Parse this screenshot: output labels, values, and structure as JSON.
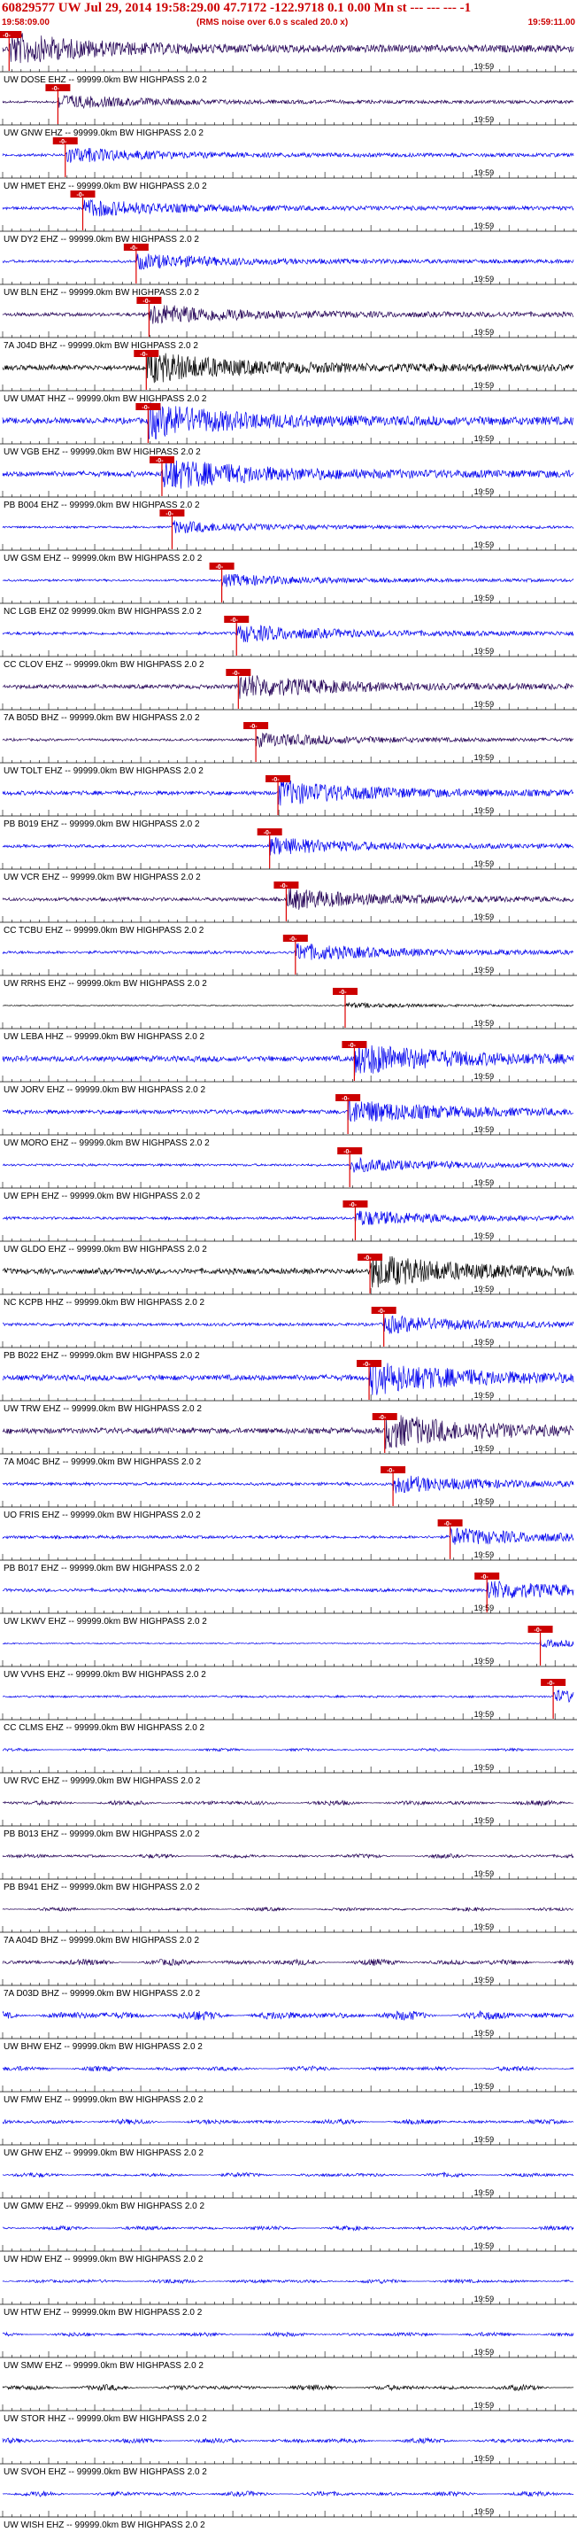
{
  "header": {
    "title": "60829577 UW Jul 29, 2014 19:58:29.00   47.7172  -122.9718   0.1 0.00 Mn st --- --- ---  -1",
    "start_time": "19:58:09.00",
    "noise_note": "(RMS noise over 6.0 s scaled 20.0 x)",
    "end_time": "19:59:11.00"
  },
  "colors": {
    "trace_blue": "#0000ee",
    "trace_purple": "#220055",
    "trace_black": "#000000",
    "pick_red": "#dd0000",
    "pick_box": "#cc0000",
    "axis": "#000000"
  },
  "chart_data": {
    "type": "line",
    "x_range": [
      "19:58:09.00",
      "19:59:11.00"
    ],
    "tick_label": "19:59",
    "tick_label_seconds": 51,
    "tick_interval_seconds": 5,
    "total_seconds": 62,
    "pick_label": "-0-",
    "traces": [
      {
        "label": "UW DOSE EHZ -- 99999.0km BW  HIGHPASS  2.0  2",
        "pick": 0.7,
        "amp": 0.9,
        "color": "purple"
      },
      {
        "label": "UW GNW EHZ -- 99999.0km BW  HIGHPASS  2.0  2",
        "pick": 6.0,
        "amp": 0.4,
        "color": "purple"
      },
      {
        "label": "UW HMET EHZ -- 99999.0km BW  HIGHPASS  2.0  2",
        "pick": 6.8,
        "amp": 0.45,
        "color": "blue"
      },
      {
        "label": "UW DY2 EHZ -- 99999.0km BW  HIGHPASS  2.0  2",
        "pick": 8.7,
        "amp": 0.5,
        "color": "blue"
      },
      {
        "label": "UW BLN EHZ -- 99999.0km BW  HIGHPASS  2.0  2",
        "pick": 14.5,
        "amp": 0.45,
        "color": "blue"
      },
      {
        "label": "7A J04D BHZ -- 99999.0km BW  HIGHPASS  2.0  2",
        "pick": 15.9,
        "amp": 0.6,
        "color": "purple"
      },
      {
        "label": "UW UMAT HHZ -- 99999.0km BW  HIGHPASS  2.0  2",
        "pick": 15.6,
        "amp": 0.9,
        "color": "black"
      },
      {
        "label": "UW VGB EHZ -- 99999.0km BW  HIGHPASS  2.0  2",
        "pick": 15.8,
        "amp": 1.0,
        "color": "blue"
      },
      {
        "label": "PB B004 EHZ -- 99999.0km BW  HIGHPASS  2.0  2",
        "pick": 17.3,
        "amp": 0.9,
        "color": "blue"
      },
      {
        "label": "UW GSM EHZ -- 99999.0km BW  HIGHPASS  2.0  2",
        "pick": 18.4,
        "amp": 0.35,
        "color": "blue"
      },
      {
        "label": "NC LGB EHZ 02 99999.0km BW  HIGHPASS  2.0  2",
        "pick": 23.8,
        "amp": 0.35,
        "color": "blue"
      },
      {
        "label": "CC CLOV EHZ -- 99999.0km BW  HIGHPASS  2.0  2",
        "pick": 25.4,
        "amp": 0.5,
        "color": "blue"
      },
      {
        "label": "7A B05D BHZ -- 99999.0km BW  HIGHPASS  2.0  2",
        "pick": 25.6,
        "amp": 0.7,
        "color": "purple"
      },
      {
        "label": "UW TOLT EHZ -- 99999.0km BW  HIGHPASS  2.0  2",
        "pick": 27.5,
        "amp": 0.4,
        "color": "purple"
      },
      {
        "label": "PB B019 EHZ -- 99999.0km BW  HIGHPASS  2.0  2",
        "pick": 29.9,
        "amp": 0.7,
        "color": "blue"
      },
      {
        "label": "UW VCR EHZ -- 99999.0km BW  HIGHPASS  2.0  2",
        "pick": 29.0,
        "amp": 0.5,
        "color": "blue"
      },
      {
        "label": "CC TCBU EHZ -- 99999.0km BW  HIGHPASS  2.0  2",
        "pick": 30.8,
        "amp": 0.6,
        "color": "purple"
      },
      {
        "label": "UW RRHS EHZ -- 99999.0km BW  HIGHPASS  2.0  2",
        "pick": 31.8,
        "amp": 0.5,
        "color": "blue"
      },
      {
        "label": "UW LEBA HHZ -- 99999.0km BW  HIGHPASS  2.0  2",
        "pick": 37.2,
        "amp": 0.15,
        "color": "black"
      },
      {
        "label": "UW JORV EHZ -- 99999.0km BW  HIGHPASS  2.0  2",
        "pick": 38.2,
        "amp": 0.95,
        "color": "blue"
      },
      {
        "label": "UW MORO EHZ -- 99999.0km BW  HIGHPASS  2.0  2",
        "pick": 37.5,
        "amp": 0.7,
        "color": "blue"
      },
      {
        "label": "UW EPH EHZ -- 99999.0km BW  HIGHPASS  2.0  2",
        "pick": 37.7,
        "amp": 0.4,
        "color": "blue"
      },
      {
        "label": "UW GLDO EHZ -- 99999.0km BW  HIGHPASS  2.0  2",
        "pick": 38.3,
        "amp": 0.45,
        "color": "blue"
      },
      {
        "label": "NC KCPB HHZ -- 99999.0km BW  HIGHPASS  2.0  2",
        "pick": 39.9,
        "amp": 0.95,
        "color": "black"
      },
      {
        "label": "PB B022 EHZ -- 99999.0km BW  HIGHPASS  2.0  2",
        "pick": 41.4,
        "amp": 0.5,
        "color": "blue"
      },
      {
        "label": "UW TRW EHZ -- 99999.0km BW  HIGHPASS  2.0  2",
        "pick": 39.8,
        "amp": 0.95,
        "color": "blue"
      },
      {
        "label": "7A M04C BHZ -- 99999.0km BW  HIGHPASS  2.0  2",
        "pick": 41.5,
        "amp": 0.95,
        "color": "purple"
      },
      {
        "label": "UO FRIS EHZ -- 99999.0km BW  HIGHPASS  2.0  2",
        "pick": 42.4,
        "amp": 0.5,
        "color": "blue"
      },
      {
        "label": "PB B017 EHZ -- 99999.0km BW  HIGHPASS  2.0  2",
        "pick": 48.6,
        "amp": 0.5,
        "color": "blue"
      },
      {
        "label": "UW LKWV EHZ -- 99999.0km BW  HIGHPASS  2.0  2",
        "pick": 52.6,
        "amp": 0.55,
        "color": "blue"
      },
      {
        "label": "UW VVHS EHZ -- 99999.0km BW  HIGHPASS  2.0  2",
        "pick": 58.4,
        "amp": 0.2,
        "color": "blue"
      },
      {
        "label": "CC CLMS EHZ -- 99999.0km BW  HIGHPASS  2.0  2",
        "pick": 59.8,
        "amp": 0.35,
        "color": "blue"
      },
      {
        "label": "UW RVC EHZ -- 99999.0km BW  HIGHPASS  2.0  2",
        "pick": null,
        "amp": 0.2,
        "color": "blue"
      },
      {
        "label": "PB B013 EHZ -- 99999.0km BW  HIGHPASS  2.0  2",
        "pick": null,
        "amp": 0.35,
        "color": "purple"
      },
      {
        "label": "PB B941 EHZ -- 99999.0km BW  HIGHPASS  2.0  2",
        "pick": null,
        "amp": 0.3,
        "color": "purple"
      },
      {
        "label": "7A A04D BHZ -- 99999.0km BW  HIGHPASS  2.0  2",
        "pick": null,
        "amp": 0.25,
        "color": "purple"
      },
      {
        "label": "7A D03D BHZ -- 99999.0km BW  HIGHPASS  2.0  2",
        "pick": null,
        "amp": 0.45,
        "color": "purple"
      },
      {
        "label": "UW BHW EHZ -- 99999.0km BW  HIGHPASS  2.0  2",
        "pick": null,
        "amp": 0.65,
        "color": "blue"
      },
      {
        "label": "UW FMW EHZ -- 99999.0km BW  HIGHPASS  2.0  2",
        "pick": null,
        "amp": 0.35,
        "color": "blue"
      },
      {
        "label": "UW GHW EHZ -- 99999.0km BW  HIGHPASS  2.0  2",
        "pick": null,
        "amp": 0.35,
        "color": "blue"
      },
      {
        "label": "UW GMW EHZ -- 99999.0km BW  HIGHPASS  2.0  2",
        "pick": null,
        "amp": 0.3,
        "color": "blue"
      },
      {
        "label": "UW HDW EHZ -- 99999.0km BW  HIGHPASS  2.0  2",
        "pick": null,
        "amp": 0.3,
        "color": "blue"
      },
      {
        "label": "UW HTW EHZ -- 99999.0km BW  HIGHPASS  2.0  2",
        "pick": null,
        "amp": 0.3,
        "color": "blue"
      },
      {
        "label": "UW SMW EHZ -- 99999.0km BW  HIGHPASS  2.0  2",
        "pick": null,
        "amp": 0.3,
        "color": "blue"
      },
      {
        "label": "UW STOR HHZ -- 99999.0km BW  HIGHPASS  2.0  2",
        "pick": null,
        "amp": 0.4,
        "color": "black"
      },
      {
        "label": "UW SVOH EHZ -- 99999.0km BW  HIGHPASS  2.0  2",
        "pick": null,
        "amp": 0.35,
        "color": "blue"
      },
      {
        "label": "UW WISH EHZ -- 99999.0km BW  HIGHPASS  2.0  2",
        "pick": null,
        "amp": 0.35,
        "color": "blue"
      }
    ]
  }
}
